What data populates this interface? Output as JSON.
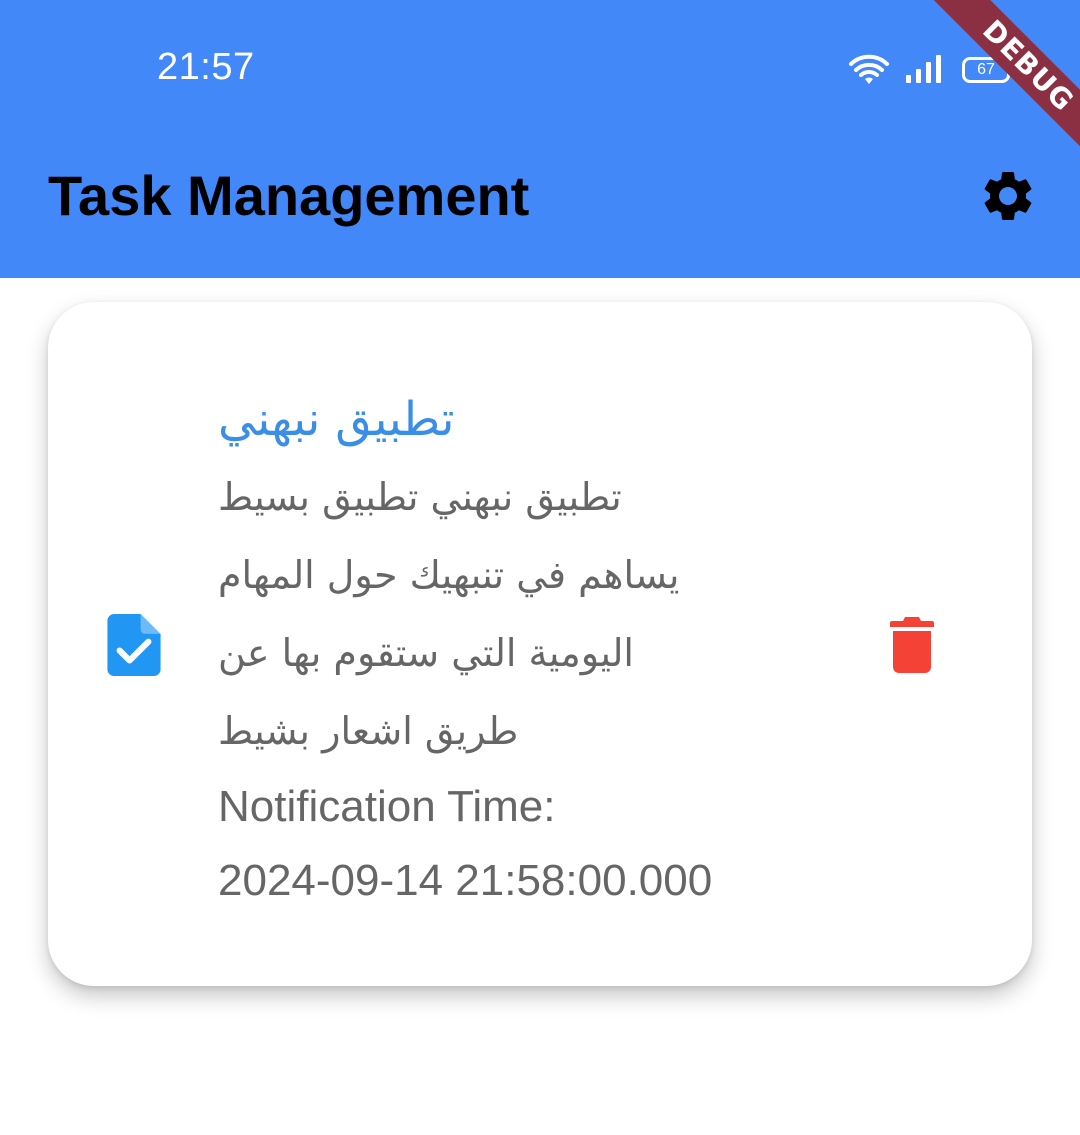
{
  "status_bar": {
    "time": "21:57",
    "battery": "67",
    "debug_label": "DEBUG"
  },
  "app_bar": {
    "title": "Task Management",
    "settings_icon": "gear-icon"
  },
  "task": {
    "icon": "task-file-check-icon",
    "title": "تطبيق نبهني",
    "description_lines": [
      "تطبيق نبهني تطبيق بسيط",
      "يساهم في تنبهيك حول المهام",
      "اليومية التي ستقوم بها عن",
      "طريق اشعار بشيط"
    ],
    "notification_label": "Notification Time:",
    "notification_time": "2024-09-14 21:58:00.000",
    "delete_icon": "trash-icon"
  },
  "colors": {
    "app_bar": "#4388F8",
    "task_title": "#3A8EE6",
    "task_icon": "#2196F3",
    "delete_icon": "#F44336",
    "body_text": "#666666",
    "debug_banner": "#8B3042"
  }
}
